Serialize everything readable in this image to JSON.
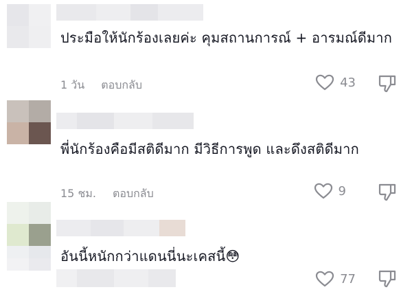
{
  "comments": [
    {
      "text": "ประมือให้นักร้องเลยค่ะ คุมสถานการณ์ + อารมณ์ดีมาก",
      "time": "1 วัน",
      "reply": "ตอบกลับ",
      "likes": "43",
      "avatar_colors": [
        "#e6e6ea",
        "#f0f0f2",
        "#e9e9ec",
        "#efeff1"
      ]
    },
    {
      "text": "พี่นักร้องคือมีสติดีมาก มีวิธีการพูด และดึงสติดีมาก",
      "time": "15 ชม.",
      "reply": "ตอบกลับ",
      "likes": "9",
      "avatar_colors": [
        "#c9c1bb",
        "#b3aca6",
        "#c9b3a6",
        "#6b5650"
      ]
    },
    {
      "text": "อันนี้หนักกว่าแดนนี่นะเคสนี้😳",
      "time": "",
      "reply": "",
      "likes": "77",
      "avatar_colors": [
        "#eef2ec",
        "#e8ece8",
        "#dfe9cf",
        "#9aa08e"
      ]
    }
  ],
  "colors": {
    "text": "#161823",
    "muted": "#8a8b91"
  },
  "icons": {
    "like": "heart-outline-icon",
    "dislike": "thumbs-down-outline-icon"
  }
}
